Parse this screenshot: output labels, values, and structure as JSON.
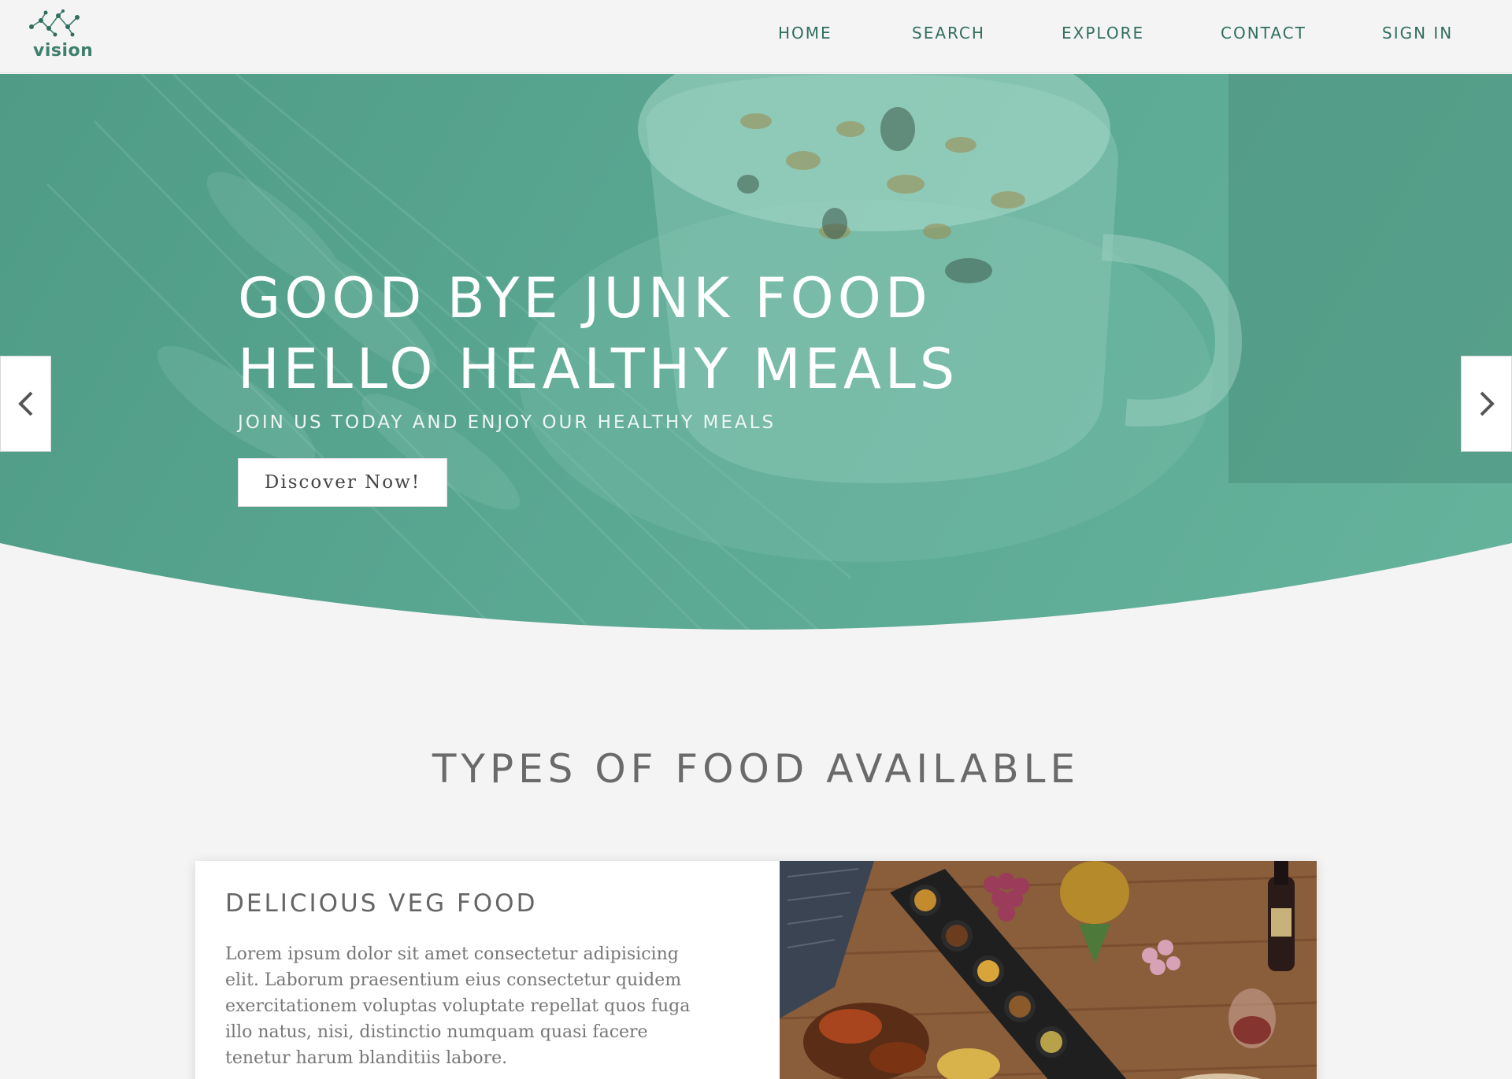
{
  "brand": {
    "name": "vision",
    "accent": "#2f6e5f",
    "hero_color": "#5aa792"
  },
  "nav": {
    "items": [
      {
        "label": "HOME"
      },
      {
        "label": "SEARCH"
      },
      {
        "label": "EXPLORE"
      },
      {
        "label": "CONTACT"
      },
      {
        "label": "SIGN IN"
      }
    ]
  },
  "hero": {
    "title_line1": "GOOD BYE JUNK FOOD",
    "title_line2": "HELLO HEALTHY MEALS",
    "subtitle": "JOIN US TODAY AND ENJOY OUR HEALTHY MEALS",
    "cta_label": "Discover Now!",
    "prev_icon": "chevron-left-icon",
    "next_icon": "chevron-right-icon"
  },
  "section": {
    "title": "TYPES OF FOOD AVAILABLE"
  },
  "card": {
    "title": "DELICIOUS VEG FOOD",
    "body": "Lorem ipsum dolor sit amet consectetur adipisicing elit. Laborum praesentium eius consectetur quidem exercitationem voluptas voluptate repellat quos fuga illo natus, nisi, distinctio numquam quasi facere tenetur harum blanditiis labore."
  }
}
